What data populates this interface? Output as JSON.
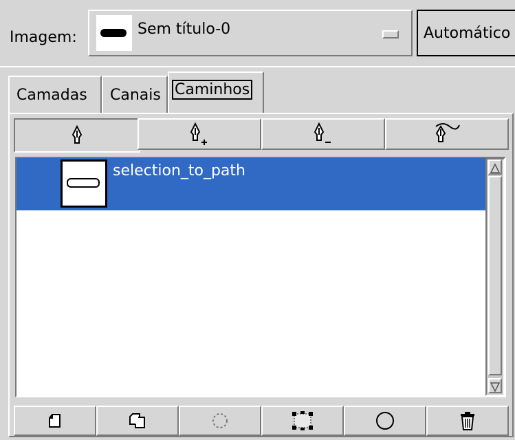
{
  "header": {
    "image_label": "Imagem:",
    "image_name": "Sem título-0",
    "auto_button_label": "Automático"
  },
  "tabs": [
    {
      "label": "Camadas",
      "active": false
    },
    {
      "label": "Canais",
      "active": false
    },
    {
      "label": "Caminhos",
      "active": true
    }
  ],
  "tool_buttons": [
    {
      "icon": "path-design-icon"
    },
    {
      "icon": "path-add-point-icon"
    },
    {
      "icon": "path-remove-point-icon"
    },
    {
      "icon": "path-edit-curve-icon"
    }
  ],
  "paths": [
    {
      "name": "selection_to_path",
      "selected": true
    }
  ],
  "action_buttons": [
    {
      "icon": "new-path-icon"
    },
    {
      "icon": "duplicate-path-icon"
    },
    {
      "icon": "path-to-selection-icon"
    },
    {
      "icon": "stroke-path-icon"
    },
    {
      "icon": "circle-path-icon"
    },
    {
      "icon": "trash-icon"
    }
  ],
  "colors": {
    "selection": "#316ac5",
    "panel": "#d6d6d6"
  }
}
